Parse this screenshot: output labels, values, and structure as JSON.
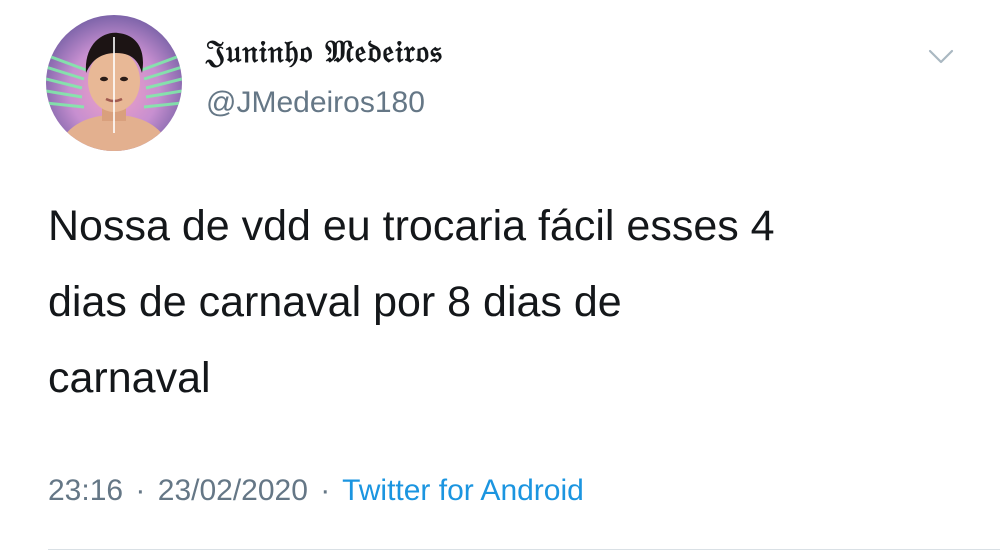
{
  "user": {
    "display_name": "𝔍𝔲𝔫𝔦𝔫𝔥𝔬 𝔐𝔢𝔡𝔢𝔦𝔯𝔬𝔰",
    "handle": "@JMedeiros180"
  },
  "tweet": {
    "text_lines": [
      "Nossa de vdd eu trocaria fácil esses 4",
      "dias de carnaval por 8 dias de",
      "carnaval"
    ],
    "time": "23:16",
    "date": "23/02/2020",
    "separator": "·",
    "source": "Twitter for Android"
  },
  "icons": {
    "caret": "chevron-down-icon",
    "avatar": "profile-photo"
  },
  "colors": {
    "text": "#14171a",
    "secondary": "#657786",
    "link": "#1b95e0",
    "divider": "#d9e0e5"
  }
}
